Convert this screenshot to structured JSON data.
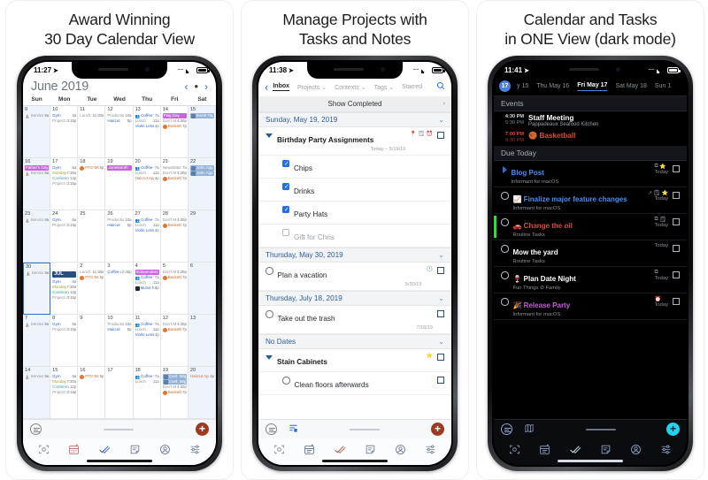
{
  "cards": [
    {
      "headline_line1": "Award Winning",
      "headline_line2": "30 Day Calendar View",
      "status": {
        "time": "11:27",
        "loc": "➤",
        "dots": "·····"
      }
    },
    {
      "headline_line1": "Manage Projects with",
      "headline_line2": "Tasks and Notes",
      "status": {
        "time": "11:38",
        "loc": "➤",
        "dots": "·····"
      }
    },
    {
      "headline_line1": "Calendar and Tasks",
      "headline_line2": "in ONE View (dark mode)",
      "status": {
        "time": "11:41",
        "loc": "➤",
        "dots": "·····"
      }
    }
  ],
  "calendar": {
    "month_label": "June 2019",
    "nav": {
      "prev": "‹",
      "today": "•",
      "next": "›"
    },
    "dow": [
      "Sun",
      "Mon",
      "Tue",
      "Wed",
      "Thu",
      "Fri",
      "Sat"
    ],
    "weeks": [
      [
        {
          "num": "9",
          "weekend": true,
          "events": [
            {
              "style": "gray",
              "icon": "church",
              "name": "Service",
              "time": "9a"
            }
          ]
        },
        {
          "num": "10",
          "events": [
            {
              "style": "blue",
              "name": "Gym",
              "time": "6a"
            },
            {
              "style": "gray",
              "name": "Project N",
              "time": "3:15p"
            }
          ]
        },
        {
          "num": "11",
          "events": [
            {
              "style": "gray",
              "name": "Lunch r",
              "time": "11:30a"
            }
          ]
        },
        {
          "num": "12",
          "events": [
            {
              "style": "gray",
              "name": "Production",
              "time": "10a"
            },
            {
              "style": "blue",
              "name": "Haircut",
              "time": "5p"
            }
          ]
        },
        {
          "num": "13",
          "events": [
            {
              "style": "blue",
              "icon": "group",
              "name": "Coffee w",
              "time": "7a"
            },
            {
              "style": "gray",
              "name": "Lunch",
              "time": "11a"
            },
            {
              "style": "blue",
              "name": "Violin Lesso",
              "time": "4p"
            }
          ]
        },
        {
          "num": "14",
          "events": [
            {
              "style": "purplefill",
              "name": "Flag Day",
              "time": ""
            },
            {
              "style": "gray",
              "name": "Don't Mow",
              "time": "4:30p"
            },
            {
              "style": "orangetxt",
              "icon": "ball",
              "name": "Basketb",
              "time": "7p"
            }
          ]
        },
        {
          "num": "15",
          "weekend": true,
          "events": [
            {
              "style": "bluefill",
              "icon": "sq",
              "name": "Event Tags",
              "time": ""
            }
          ]
        }
      ],
      [
        {
          "num": "16",
          "weekend": true,
          "events": [
            {
              "style": "purplefill",
              "name": "Father's Day",
              "time": ""
            },
            {
              "style": "gray",
              "icon": "church",
              "name": "Service",
              "time": "9a"
            }
          ]
        },
        {
          "num": "17",
          "events": [
            {
              "style": "blue",
              "name": "Gym",
              "time": "6a"
            },
            {
              "style": "olive",
              "name": "Monday",
              "time": "7:30a"
            },
            {
              "style": "teal",
              "name": "Conference",
              "time": "12p"
            },
            {
              "style": "gray",
              "name": "Project N",
              "time": "3:15p"
            }
          ]
        },
        {
          "num": "18",
          "events": [
            {
              "style": "orangetxt",
              "icon": "ball",
              "name": "PTO Mo",
              "time": "6p"
            }
          ]
        },
        {
          "num": "19",
          "events": [
            {
              "style": "purplefill",
              "name": "Juneteenth",
              "time": ""
            }
          ]
        },
        {
          "num": "20",
          "events": [
            {
              "style": "blue",
              "icon": "group",
              "name": "Coffee w",
              "time": "7a"
            },
            {
              "style": "gray",
              "name": "Lunch",
              "time": "11a"
            },
            {
              "style": "orangetxt",
              "name": "Haircut Appt",
              "time": "4p"
            }
          ]
        },
        {
          "num": "21",
          "events": [
            {
              "style": "gray",
              "name": "Newsletter d",
              "time": "7a"
            },
            {
              "style": "gray",
              "name": "Don't Mow",
              "time": "4:30p"
            },
            {
              "style": "orangetxt",
              "icon": "ball",
              "name": "Basketb",
              "time": "7p"
            }
          ]
        },
        {
          "num": "22",
          "weekend": true,
          "events": [
            {
              "style": "bluefill",
              "icon": "sq",
              "name": "John Appt",
              "time": ""
            },
            {
              "style": "bluefill",
              "icon": "sq",
              "name": "John Appt",
              "time": ""
            }
          ]
        }
      ],
      [
        {
          "num": "23",
          "weekend": true,
          "events": [
            {
              "style": "gray",
              "icon": "church",
              "name": "Service",
              "time": "9a"
            }
          ]
        },
        {
          "num": "24",
          "events": [
            {
              "style": "blue",
              "name": "Gym",
              "time": "6a"
            },
            {
              "style": "gray",
              "name": "Project N",
              "time": "3:15p"
            }
          ]
        },
        {
          "num": "25",
          "events": []
        },
        {
          "num": "26",
          "events": [
            {
              "style": "gray",
              "name": "Production",
              "time": "10a"
            },
            {
              "style": "blue",
              "name": "Haircut",
              "time": "5p"
            }
          ]
        },
        {
          "num": "27",
          "events": [
            {
              "style": "blue",
              "icon": "group",
              "name": "Coffee w",
              "time": "7a"
            },
            {
              "style": "gray",
              "name": "Lunch",
              "time": "11a"
            },
            {
              "style": "blue",
              "name": "Violin Lesso",
              "time": "4p"
            }
          ]
        },
        {
          "num": "28",
          "events": [
            {
              "style": "gray",
              "name": "Don't Mow",
              "time": "4:30p"
            },
            {
              "style": "orangetxt",
              "icon": "ball",
              "name": "Basketb",
              "time": "7p"
            }
          ]
        },
        {
          "num": "29",
          "weekend": true,
          "events": []
        }
      ],
      [
        {
          "num": "30",
          "weekend": true,
          "selected": true,
          "events": [
            {
              "style": "gray",
              "icon": "church",
              "name": "Service",
              "time": "9a"
            }
          ]
        },
        {
          "num": "JUL",
          "month_start": true,
          "events": [
            {
              "style": "blue",
              "name": "Gym",
              "time": "6a"
            },
            {
              "style": "olive",
              "name": "Monday",
              "time": "7:30a"
            },
            {
              "style": "teal",
              "name": "Conference",
              "time": "12p"
            },
            {
              "style": "gray",
              "name": "Project N",
              "time": "3:15p"
            }
          ]
        },
        {
          "num": "2",
          "events": [
            {
              "style": "gray",
              "name": "Lunch r",
              "time": "11:30a"
            },
            {
              "style": "orangetxt",
              "icon": "ball",
              "name": "PTO Mo",
              "time": "6p"
            }
          ]
        },
        {
          "num": "3",
          "events": [
            {
              "style": "blue",
              "name": "Coffee at",
              "time": "2:30p"
            }
          ]
        },
        {
          "num": "4",
          "events": [
            {
              "style": "purplefill",
              "name": "Independence",
              "time": ""
            },
            {
              "style": "blue",
              "icon": "group",
              "name": "Coffee w",
              "time": "7a"
            },
            {
              "style": "gray",
              "name": "Lunch",
              "time": "11a"
            },
            {
              "style": "blue",
              "icon": "sqdark",
              "name": "Movie N",
              "time": "8p"
            }
          ]
        },
        {
          "num": "5",
          "events": [
            {
              "style": "gray",
              "name": "Don't Mow",
              "time": "4:30p"
            },
            {
              "style": "orangetxt",
              "icon": "ball",
              "name": "Basketb",
              "time": "7p"
            }
          ]
        },
        {
          "num": "6",
          "weekend": true,
          "events": []
        }
      ],
      [
        {
          "num": "7",
          "weekend": true,
          "events": [
            {
              "style": "gray",
              "icon": "church",
              "name": "Service",
              "time": "9a"
            }
          ]
        },
        {
          "num": "8",
          "events": [
            {
              "style": "blue",
              "name": "Gym",
              "time": "6a"
            },
            {
              "style": "gray",
              "name": "Project N",
              "time": "3:15p"
            }
          ]
        },
        {
          "num": "9",
          "events": []
        },
        {
          "num": "10",
          "events": [
            {
              "style": "gray",
              "name": "Production",
              "time": "10a"
            },
            {
              "style": "blue",
              "name": "Haircut",
              "time": "5p"
            }
          ]
        },
        {
          "num": "11",
          "events": [
            {
              "style": "blue",
              "icon": "group",
              "name": "Coffee w",
              "time": "7a"
            },
            {
              "style": "gray",
              "name": "Lunch",
              "time": "11a"
            },
            {
              "style": "blue",
              "name": "Violin Lesso",
              "time": "4p"
            }
          ]
        },
        {
          "num": "12",
          "events": [
            {
              "style": "gray",
              "name": "Don't Mow",
              "time": "4:30p"
            },
            {
              "style": "orangetxt",
              "icon": "ball",
              "name": "Basketb",
              "time": "7p"
            }
          ]
        },
        {
          "num": "13",
          "weekend": true,
          "events": []
        }
      ],
      [
        {
          "num": "14",
          "weekend": true,
          "events": [
            {
              "style": "gray",
              "icon": "church",
              "name": "Service",
              "time": "9a"
            }
          ]
        },
        {
          "num": "15",
          "events": [
            {
              "style": "blue",
              "name": "Gym",
              "time": "6a"
            },
            {
              "style": "olive",
              "name": "Monday",
              "time": "7:30a"
            },
            {
              "style": "teal",
              "name": "Conference",
              "time": "12p"
            },
            {
              "style": "gray",
              "name": "Project N",
              "time": "3:15p"
            }
          ]
        },
        {
          "num": "16",
          "events": [
            {
              "style": "orangetxt",
              "icon": "ball",
              "name": "PTO Mo",
              "time": "6p"
            }
          ]
        },
        {
          "num": "17",
          "events": []
        },
        {
          "num": "18",
          "events": [
            {
              "style": "blue",
              "icon": "group",
              "name": "Coffee w",
              "time": "7a"
            },
            {
              "style": "gray",
              "name": "Lunch",
              "time": "11a"
            }
          ]
        },
        {
          "num": "19",
          "events": [
            {
              "style": "bluefill",
              "icon": "sq",
              "name": "Conf. Mtg",
              "time": ""
            },
            {
              "style": "bluefill",
              "icon": "sq",
              "name": "Conf. Mtg",
              "time": ""
            },
            {
              "style": "gray",
              "name": "Don't Mow",
              "time": "4:30p"
            },
            {
              "style": "orangetxt",
              "icon": "ball",
              "name": "Basketb",
              "time": "7p"
            }
          ]
        },
        {
          "num": "20",
          "weekend": true,
          "events": [
            {
              "style": "orangetxt",
              "name": "Haircut Appt",
              "time": "4p"
            }
          ]
        }
      ]
    ]
  },
  "tasks": {
    "back_label": "‹",
    "tabs": [
      {
        "label": "Inbox",
        "active": true
      },
      {
        "label": "Projects ⌄",
        "active": false
      },
      {
        "label": "Contexts ⌄",
        "active": false
      },
      {
        "label": "Tags ⌄",
        "active": false
      },
      {
        "label": "Starred",
        "active": false
      }
    ],
    "search_icon": "search-icon",
    "show_completed": "Show Completed",
    "sections": [
      {
        "title": "Sunday, May 19, 2019",
        "rows": [
          {
            "type": "project",
            "label": "Birthday Party Assignments",
            "meta": "Today – 5/19/19",
            "icons": "pin-icon note-icon alarm-icon",
            "box": true
          },
          {
            "type": "task",
            "label": "Chips",
            "checked": true,
            "indent": true
          },
          {
            "type": "task",
            "label": "Drinks",
            "checked": true,
            "indent": true
          },
          {
            "type": "task",
            "label": "Party Hats",
            "checked": true,
            "indent": true
          },
          {
            "type": "task",
            "label": "Gift for Chris",
            "checked": false,
            "indent": true,
            "muted": true
          }
        ]
      },
      {
        "title": "Thursday, May 30, 2019",
        "rows": [
          {
            "type": "radio",
            "label": "Plan a vacation",
            "meta": "5/30/19",
            "icons": "clock-icon",
            "box": true
          }
        ]
      },
      {
        "title": "Thursday, July 18, 2019",
        "rows": [
          {
            "type": "radio",
            "label": "Take out the trash",
            "meta": "7/18/19",
            "box": true
          }
        ]
      },
      {
        "title": "No Dates",
        "rows": [
          {
            "type": "project",
            "label": "Stain Cabinets",
            "icons": "star-icon",
            "box": true
          },
          {
            "type": "radio",
            "label": "Clean floors afterwards",
            "indent": true,
            "box": true
          }
        ]
      }
    ]
  },
  "dark": {
    "today_badge": "17",
    "days": [
      {
        "label": "y 15",
        "active": false
      },
      {
        "label": "Thu May 16",
        "active": false
      },
      {
        "label": "Fri May 17",
        "active": true
      },
      {
        "label": "Sat May 18",
        "active": false
      },
      {
        "label": "Sun 1",
        "active": false
      }
    ],
    "events_header": "Events",
    "events": [
      {
        "start": "4:30 PM",
        "end": "5:30 PM",
        "title": "Staff Meeting",
        "sub": "Pappadeaux Seafood Kitchen",
        "red": false
      },
      {
        "start": "7:00 PM",
        "end": "8:30 PM",
        "title": "Basketball",
        "sub": "",
        "red": true,
        "icon": "basketball-icon"
      }
    ],
    "due_header": "Due Today",
    "tasks": [
      {
        "title": "Blog Post",
        "sub": "Informant for macOS",
        "due": "Today",
        "color": "#4a8ff0",
        "caret": true,
        "icons": "copy-icon star-icon"
      },
      {
        "title": "Finalize major feature changes",
        "sub": "Informant for macOS",
        "due": "Today",
        "color": "#4a8ff0",
        "emoji": "📈",
        "icons": "share-icon note-icon star-icon"
      },
      {
        "title": "Change the oil",
        "sub": "Routine Tasks",
        "due": "Today",
        "color": "#e0493b",
        "emoji": "🚗",
        "icons": "copy-icon note-icon",
        "flag": true
      },
      {
        "title": "Mow the yard",
        "sub": "Routine Tasks",
        "due": "Today",
        "color": "#ffffff"
      },
      {
        "title": "Plan Date Night",
        "sub": "Fun Things   ⊘ Family",
        "due": "Today",
        "color": "#ffffff",
        "emoji": "🍷",
        "icons": "copy-icon"
      },
      {
        "title": "Release Party",
        "sub": "Informant for macOS",
        "due": "Today",
        "color": "#cc5be0",
        "emoji": "🎉",
        "icons": "alarm-icon"
      }
    ]
  },
  "toolbar": {
    "menu_icon": "hamburger-circle-icon",
    "add_icon": "plus-button",
    "filter_icon": "filter-icon",
    "map_icon": "map-icon",
    "tabs": [
      "focus-icon",
      "calendar-icon",
      "tasks-check-icon",
      "notes-icon",
      "contacts-icon",
      "settings-sliders-icon"
    ]
  }
}
